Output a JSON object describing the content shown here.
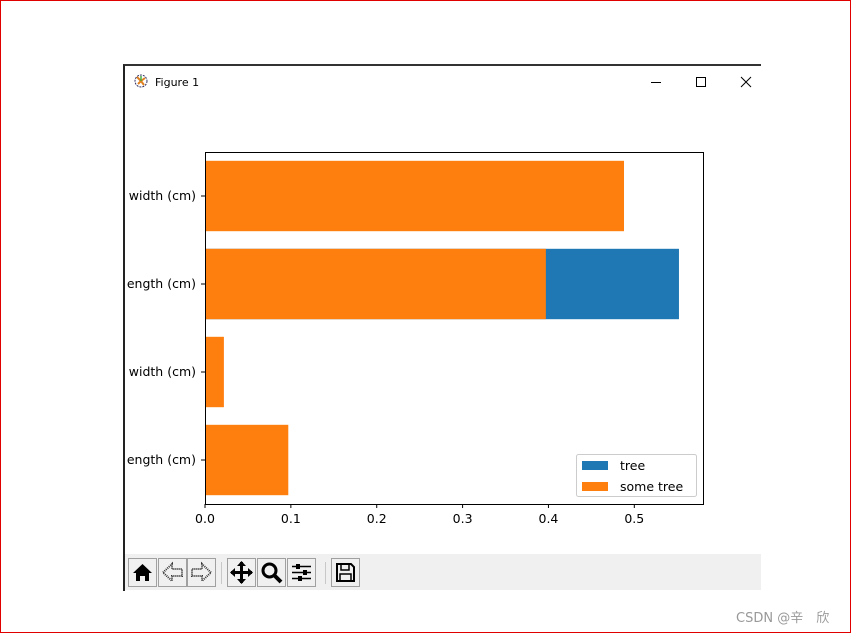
{
  "window": {
    "title": "Figure 1",
    "controls": [
      "minimize",
      "maximize",
      "close"
    ]
  },
  "toolbar": {
    "buttons": [
      {
        "name": "home-icon",
        "label": "Home"
      },
      {
        "name": "back-icon",
        "label": "Back"
      },
      {
        "name": "forward-icon",
        "label": "Forward"
      },
      {
        "name": "pan-icon",
        "label": "Pan"
      },
      {
        "name": "zoom-icon",
        "label": "Zoom"
      },
      {
        "name": "configure-subplots-icon",
        "label": "Configure subplots"
      },
      {
        "name": "save-icon",
        "label": "Save"
      }
    ]
  },
  "chart_data": {
    "type": "bar",
    "orientation": "horizontal",
    "categories": [
      "ength (cm)",
      "width (cm)",
      "ength (cm)",
      "width (cm)"
    ],
    "series": [
      {
        "name": "tree",
        "color": "#1f77b4",
        "values": [
          null,
          null,
          0.552,
          null
        ]
      },
      {
        "name": "some tree",
        "color": "#ff7f0e",
        "values": [
          0.097,
          0.022,
          0.397,
          0.488
        ]
      }
    ],
    "xlim": [
      0,
      0.58
    ],
    "xticks": [
      "0.0",
      "0.1",
      "0.2",
      "0.3",
      "0.4",
      "0.5"
    ],
    "grid": false,
    "legend": "lower-right"
  },
  "watermark": "CSDN @辛　欣"
}
